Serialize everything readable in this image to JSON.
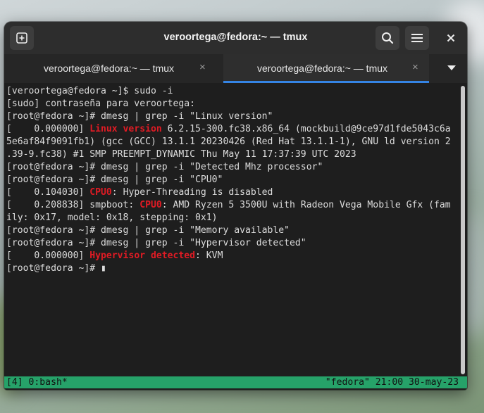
{
  "window": {
    "title": "veroortega@fedora:~ — tmux"
  },
  "tabs": [
    {
      "label": "veroortega@fedora:~ — tmux",
      "active": false
    },
    {
      "label": "veroortega@fedora:~ — tmux",
      "active": true
    }
  ],
  "icons": {
    "new_tab": "plus-square-icon",
    "search": "search-icon",
    "menu": "hamburger-menu-icon",
    "close": "close-icon",
    "tab_close": "×",
    "tabs_dropdown": "chevron-down-icon"
  },
  "colors": {
    "highlight": "#e01b24",
    "status_bar": "#26a269",
    "tab_accent": "#3584e4"
  },
  "terminal": {
    "lines": [
      [
        {
          "t": "[veroortega@fedora ~]$ sudo -i"
        }
      ],
      [
        {
          "t": "[sudo] contraseña para veroortega:"
        }
      ],
      [
        {
          "t": "[root@fedora ~]# dmesg | grep -i \"Linux version\""
        }
      ],
      [
        {
          "t": "[    0.000000] "
        },
        {
          "t": "Linux version",
          "hl": true
        },
        {
          "t": " 6.2.15-300.fc38.x86_64 (mockbuild@9ce97d1fde5043c6a"
        }
      ],
      [
        {
          "t": "5e6af84f9091fb1) (gcc (GCC) 13.1.1 20230426 (Red Hat 13.1.1-1), GNU ld version 2"
        }
      ],
      [
        {
          "t": ".39-9.fc38) #1 SMP PREEMPT_DYNAMIC Thu May 11 17:37:39 UTC 2023"
        }
      ],
      [
        {
          "t": "[root@fedora ~]# dmesg | grep -i \"Detected Mhz processor\""
        }
      ],
      [
        {
          "t": "[root@fedora ~]# dmesg | grep -i \"CPU0\""
        }
      ],
      [
        {
          "t": "[    0.104030] "
        },
        {
          "t": "CPU0",
          "hl": true
        },
        {
          "t": ": Hyper-Threading is disabled"
        }
      ],
      [
        {
          "t": "[    0.208838] smpboot: "
        },
        {
          "t": "CPU0",
          "hl": true
        },
        {
          "t": ": AMD Ryzen 5 3500U with Radeon Vega Mobile Gfx (fam"
        }
      ],
      [
        {
          "t": "ily: 0x17, model: 0x18, stepping: 0x1)"
        }
      ],
      [
        {
          "t": "[root@fedora ~]# dmesg | grep -i \"Memory available\""
        }
      ],
      [
        {
          "t": "[root@fedora ~]# dmesg | grep -i \"Hypervisor detected\""
        }
      ],
      [
        {
          "t": "[    0.000000] "
        },
        {
          "t": "Hypervisor detected",
          "hl": true
        },
        {
          "t": ": KVM"
        }
      ],
      [
        {
          "t": "[root@fedora ~]# "
        },
        {
          "t": "▮",
          "cursor": true
        }
      ]
    ]
  },
  "status_bar": {
    "left": "[4] 0:bash*",
    "right": "\"fedora\" 21:00 30-may-23"
  }
}
